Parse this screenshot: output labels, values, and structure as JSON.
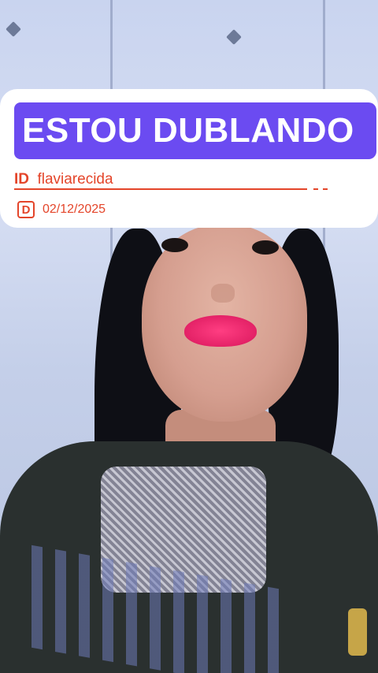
{
  "overlay": {
    "banner_text": "ESTOU DUBLANDO",
    "id_prefix": "ID",
    "id_user": "flaviarecida",
    "date_badge": "D",
    "date": "02/12/2025"
  },
  "colors": {
    "banner": "#6b4bf1",
    "accent": "#e4452a",
    "card": "#ffffff"
  }
}
